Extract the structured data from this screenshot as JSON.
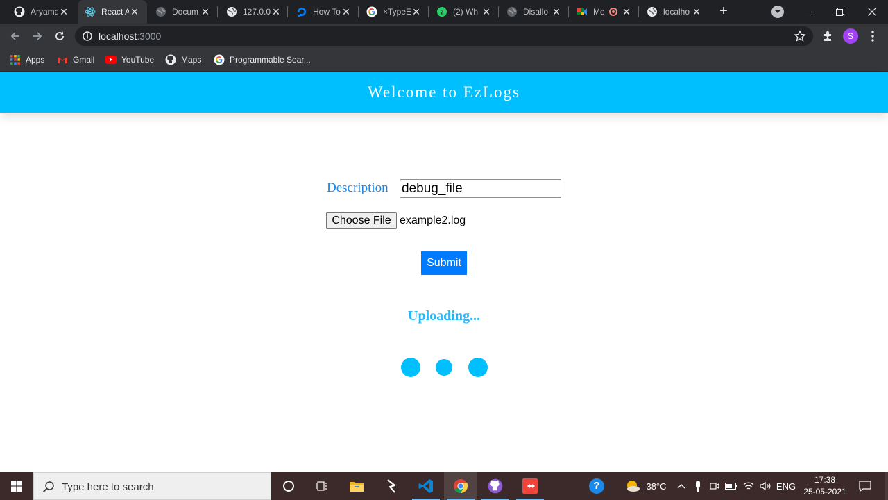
{
  "browser": {
    "tabs": [
      {
        "title": "Aryama",
        "icon": "github-icon"
      },
      {
        "title": "React A",
        "icon": "react-icon",
        "active": true
      },
      {
        "title": "Docum",
        "icon": "globe-icon"
      },
      {
        "title": "127.0.0",
        "icon": "globe-icon"
      },
      {
        "title": "How To",
        "icon": "digitalocean-icon"
      },
      {
        "title": "×TypeE",
        "icon": "google-icon"
      },
      {
        "title": "(2) Wh",
        "icon": "whatsapp-icon"
      },
      {
        "title": "Disallo",
        "icon": "globe-icon"
      },
      {
        "title": "Me",
        "icon": "meet-icon"
      },
      {
        "title": "localho",
        "icon": "globe-icon"
      }
    ],
    "new_tab": "+",
    "address": {
      "host": "localhost",
      "port": ":3000"
    },
    "profile_initial": "S",
    "bookmarks": [
      {
        "label": "Apps",
        "icon": "apps-grid-icon"
      },
      {
        "label": "Gmail",
        "icon": "gmail-icon"
      },
      {
        "label": "YouTube",
        "icon": "youtube-icon"
      },
      {
        "label": "Maps",
        "icon": "github-icon"
      },
      {
        "label": "Programmable Sear...",
        "icon": "google-icon"
      }
    ]
  },
  "page": {
    "header_title": "Welcome to EzLogs",
    "description_label": "Description",
    "description_value": "debug_file",
    "choose_file_label": "Choose File",
    "file_name": "example2.log",
    "submit_label": "Submit",
    "status_text": "Uploading...",
    "accent_color": "#00bfff",
    "button_color": "#007bff"
  },
  "taskbar": {
    "search_placeholder": "Type here to search",
    "weather_temp": "38°C",
    "language": "ENG",
    "time": "17:38",
    "date": "25-05-2021"
  }
}
